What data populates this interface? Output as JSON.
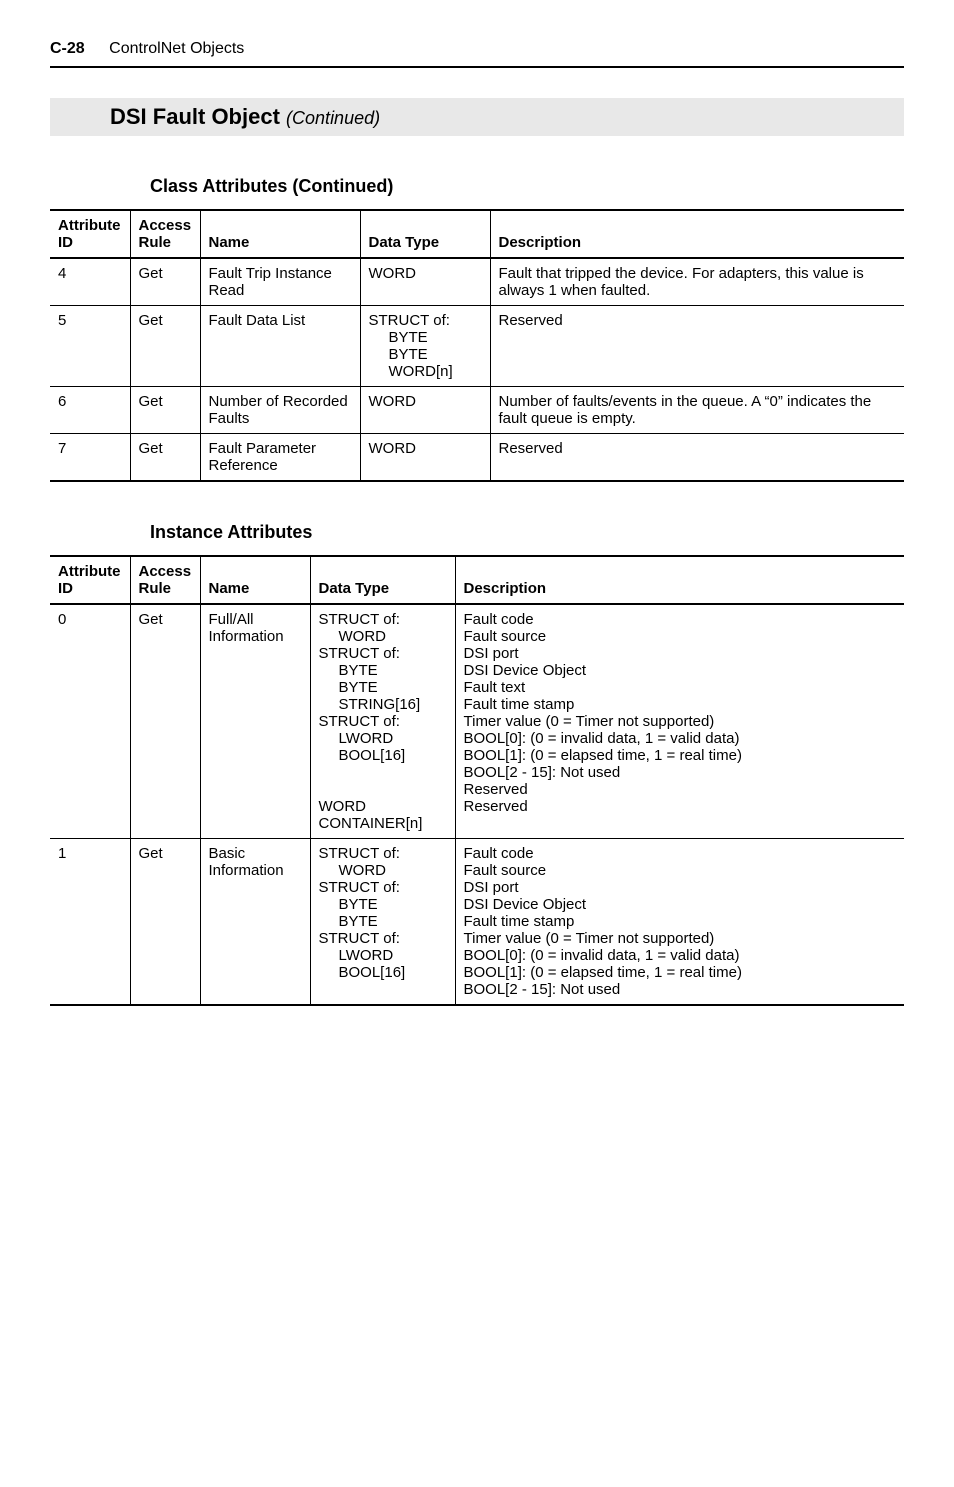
{
  "header": {
    "page_num": "C-28",
    "page_title": "ControlNet Objects"
  },
  "section": {
    "title": "DSI Fault Object",
    "continued": "(Continued)"
  },
  "table1": {
    "heading": "Class Attributes (Continued)",
    "columns": {
      "attr_id": "Attribute ID",
      "access": "Access Rule",
      "name": "Name",
      "dtype": "Data Type",
      "desc": "Description"
    },
    "rows": [
      {
        "attr_id": "4",
        "access": "Get",
        "name": "Fault Trip Instance Read",
        "dtype": "WORD",
        "desc": "Fault that tripped the device. For adapters, this value is always 1 when faulted."
      },
      {
        "attr_id": "5",
        "access": "Get",
        "name": "Fault Data List",
        "dtype_lines": [
          "STRUCT of:",
          "BYTE",
          "BYTE",
          "WORD[n]"
        ],
        "desc": "Reserved"
      },
      {
        "attr_id": "6",
        "access": "Get",
        "name": "Number of Recorded Faults",
        "dtype": "WORD",
        "desc": "Number of faults/events in the queue. A “0” indicates the fault queue is empty."
      },
      {
        "attr_id": "7",
        "access": "Get",
        "name": "Fault Parameter Reference",
        "dtype": "WORD",
        "desc": "Reserved"
      }
    ]
  },
  "table2": {
    "heading": "Instance Attributes",
    "columns": {
      "attr_id": "Attribute ID",
      "access": "Access Rule",
      "name": "Name",
      "dtype": "Data Type",
      "desc": "Description"
    },
    "rows": [
      {
        "attr_id": "0",
        "access": "Get",
        "name": "Full/All Information",
        "dtype_lines": [
          {
            "t": "STRUCT of:",
            "i": 0
          },
          {
            "t": "WORD",
            "i": 1
          },
          {
            "t": "STRUCT of:",
            "i": 0
          },
          {
            "t": "BYTE",
            "i": 1
          },
          {
            "t": "BYTE",
            "i": 1
          },
          {
            "t": "STRING[16]",
            "i": 1
          },
          {
            "t": "STRUCT of:",
            "i": 0
          },
          {
            "t": "LWORD",
            "i": 1
          },
          {
            "t": "BOOL[16]",
            "i": 1
          },
          {
            "t": " ",
            "i": 0
          },
          {
            "t": " ",
            "i": 0
          },
          {
            "t": "WORD",
            "i": 0
          },
          {
            "t": "CONTAINER[n]",
            "i": 0
          }
        ],
        "desc_lines": [
          "",
          "Fault code",
          "Fault source",
          "DSI port",
          "DSI Device Object",
          "Fault text",
          "Fault time stamp",
          "Timer value (0 = Timer not supported)",
          "BOOL[0]: (0 = invalid data, 1 = valid data)",
          "BOOL[1]: (0 = elapsed time, 1 = real time)",
          "BOOL[2 - 15]: Not used",
          "Reserved",
          "Reserved"
        ]
      },
      {
        "attr_id": "1",
        "access": "Get",
        "name": "Basic Information",
        "dtype_lines": [
          {
            "t": "STRUCT of:",
            "i": 0
          },
          {
            "t": "WORD",
            "i": 1
          },
          {
            "t": "STRUCT of:",
            "i": 0
          },
          {
            "t": "BYTE",
            "i": 1
          },
          {
            "t": "BYTE",
            "i": 1
          },
          {
            "t": "STRUCT of:",
            "i": 0
          },
          {
            "t": "LWORD",
            "i": 1
          },
          {
            "t": "BOOL[16]",
            "i": 1
          }
        ],
        "desc_lines": [
          "",
          "Fault code",
          "Fault source",
          "DSI port",
          "DSI Device Object",
          "Fault time stamp",
          "Timer value (0 = Timer not supported)",
          "BOOL[0]: (0 = invalid data, 1 = valid data)",
          "BOOL[1]: (0 = elapsed time, 1 = real time)",
          "BOOL[2 - 15]: Not used"
        ]
      }
    ]
  }
}
